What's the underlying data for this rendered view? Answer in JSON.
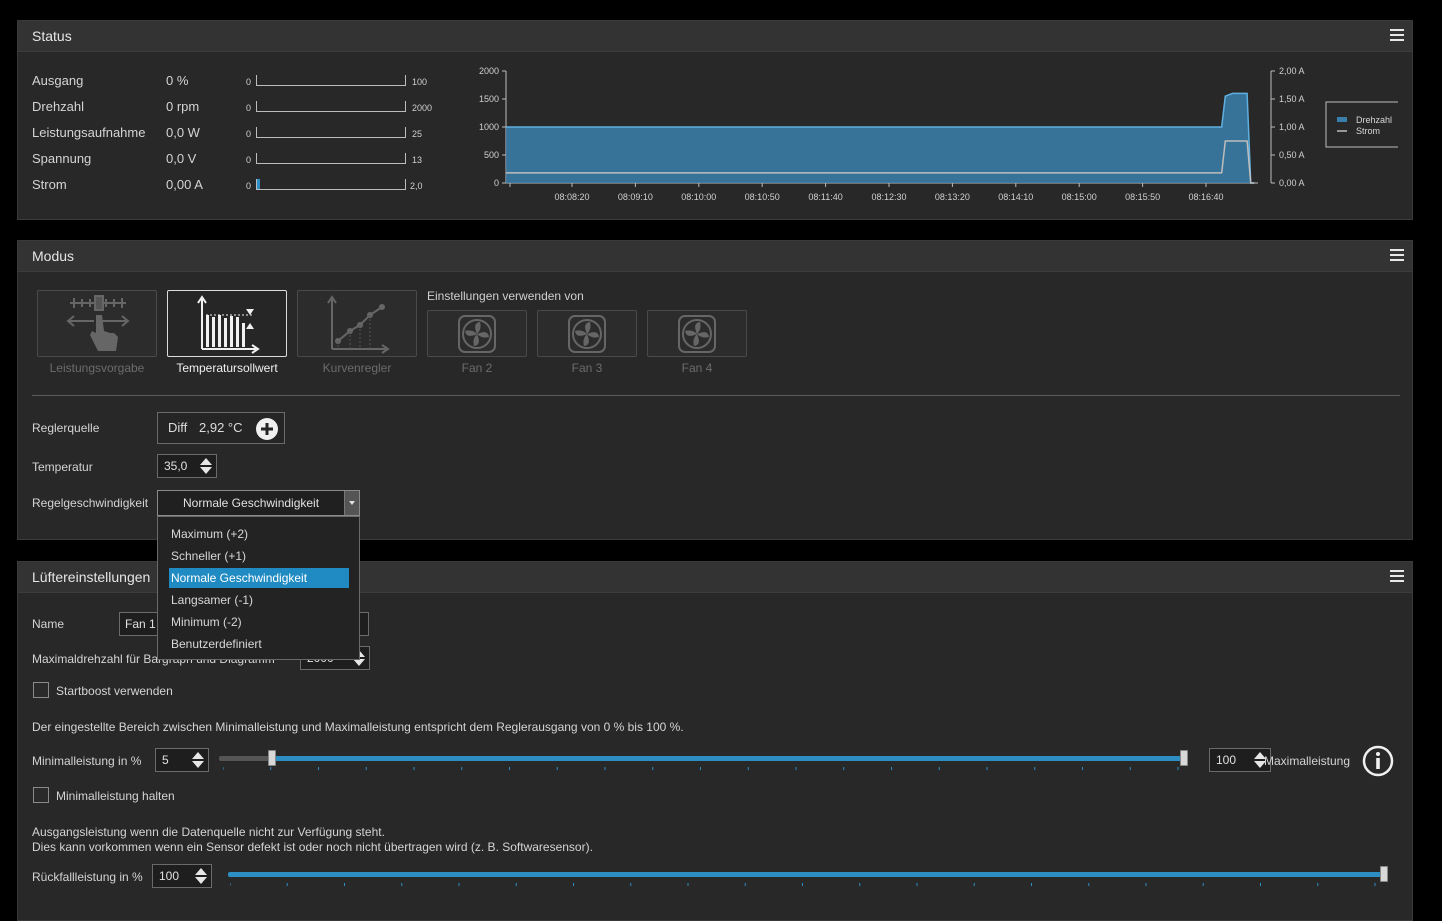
{
  "status": {
    "title": "Status",
    "rows": [
      {
        "label": "Ausgang",
        "value": "0 %",
        "min": "0",
        "max": "100",
        "fill": 0
      },
      {
        "label": "Drehzahl",
        "value": "0 rpm",
        "min": "0",
        "max": "2000",
        "fill": 0
      },
      {
        "label": "Leistungsaufnahme",
        "value": "0,0 W",
        "min": "0",
        "max": "25",
        "fill": 0
      },
      {
        "label": "Spannung",
        "value": "0,0 V",
        "min": "0",
        "max": "13",
        "fill": 0
      },
      {
        "label": "Strom",
        "value": "0,00 A",
        "min": "0",
        "max": "2,0",
        "fill": 0.02
      }
    ]
  },
  "chart_data": {
    "type": "area",
    "x_ticks": [
      "08:08:20",
      "08:09:10",
      "08:10:00",
      "08:10:50",
      "08:11:40",
      "08:12:30",
      "08:13:20",
      "08:14:10",
      "08:15:00",
      "08:15:50",
      "08:16:40"
    ],
    "y_left_ticks": [
      "2000",
      "1500",
      "1000",
      "500",
      "0"
    ],
    "y_right_ticks": [
      "2,00 A",
      "1,50 A",
      "1,00 A",
      "0,50 A",
      "0,00 A"
    ],
    "ylim_left": [
      0,
      2000
    ],
    "ylim_right": [
      0,
      2.0
    ],
    "legend": [
      "Drehzahl",
      "Strom"
    ],
    "legend_placement": "top-right",
    "colors": {
      "Drehzahl": "#3a7fab",
      "Strom": "#bdbdbd"
    },
    "series": [
      {
        "name": "Drehzahl",
        "t": [
          0,
          0.97,
          0.985,
          0.99,
          1.0,
          1.02,
          1.025,
          1.03
        ],
        "values": [
          1000,
          1000,
          1000,
          1550,
          1600,
          1600,
          0,
          0
        ]
      },
      {
        "name": "Strom",
        "t": [
          0,
          0.97,
          0.985,
          0.99,
          1.0,
          1.02,
          1.025,
          1.03
        ],
        "values": [
          0.18,
          0.18,
          0.18,
          0.75,
          0.75,
          0.75,
          0,
          0
        ]
      }
    ]
  },
  "modus": {
    "title": "Modus",
    "modes": [
      {
        "label": "Leistungsvorgabe"
      },
      {
        "label": "Temperatursollwert"
      },
      {
        "label": "Kurvenregler"
      }
    ],
    "use_settings_label": "Einstellungen verwenden von",
    "fans": [
      {
        "label": "Fan 2"
      },
      {
        "label": "Fan 3"
      },
      {
        "label": "Fan 4"
      }
    ],
    "source_label": "Reglerquelle",
    "source_name": "Diff",
    "source_value": "2,92 °C",
    "temp_label": "Temperatur",
    "temp_value": "35,0",
    "speed_label": "Regelgeschwindigkeit",
    "speed_value": "Normale Geschwindigkeit",
    "speed_options": [
      "Maximum (+2)",
      "Schneller (+1)",
      "Normale Geschwindigkeit",
      "Langsamer (-1)",
      "Minimum (-2)",
      "Benutzerdefiniert"
    ],
    "speed_selected_index": 2
  },
  "fan": {
    "title": "Lüftereinstellungen",
    "name_label": "Name",
    "name_value": "Fan 1",
    "max_rpm_label": "Maximaldrehzahl für Bargraph und Diagramm",
    "max_rpm_value": "2000",
    "startboost_label": "Startboost verwenden",
    "range_note": "Der eingestellte Bereich zwischen Minimalleistung und Maximalleistung entspricht dem Reglerausgang von 0 % bis 100 %.",
    "min_label": "Minimalleistung in %",
    "min_value": "5",
    "max_value": "100",
    "max_label": "Maximalleistung",
    "hold_min_label": "Minimalleistung halten",
    "fallback_note1": "Ausgangsleistung wenn die Datenquelle nicht zur Verfügung steht.",
    "fallback_note2": "Dies kann vorkommen wenn ein Sensor defekt ist oder noch nicht übertragen wird (z. B. Softwaresensor).",
    "fallback_label": "Rückfallleistung in %",
    "fallback_value": "100"
  }
}
